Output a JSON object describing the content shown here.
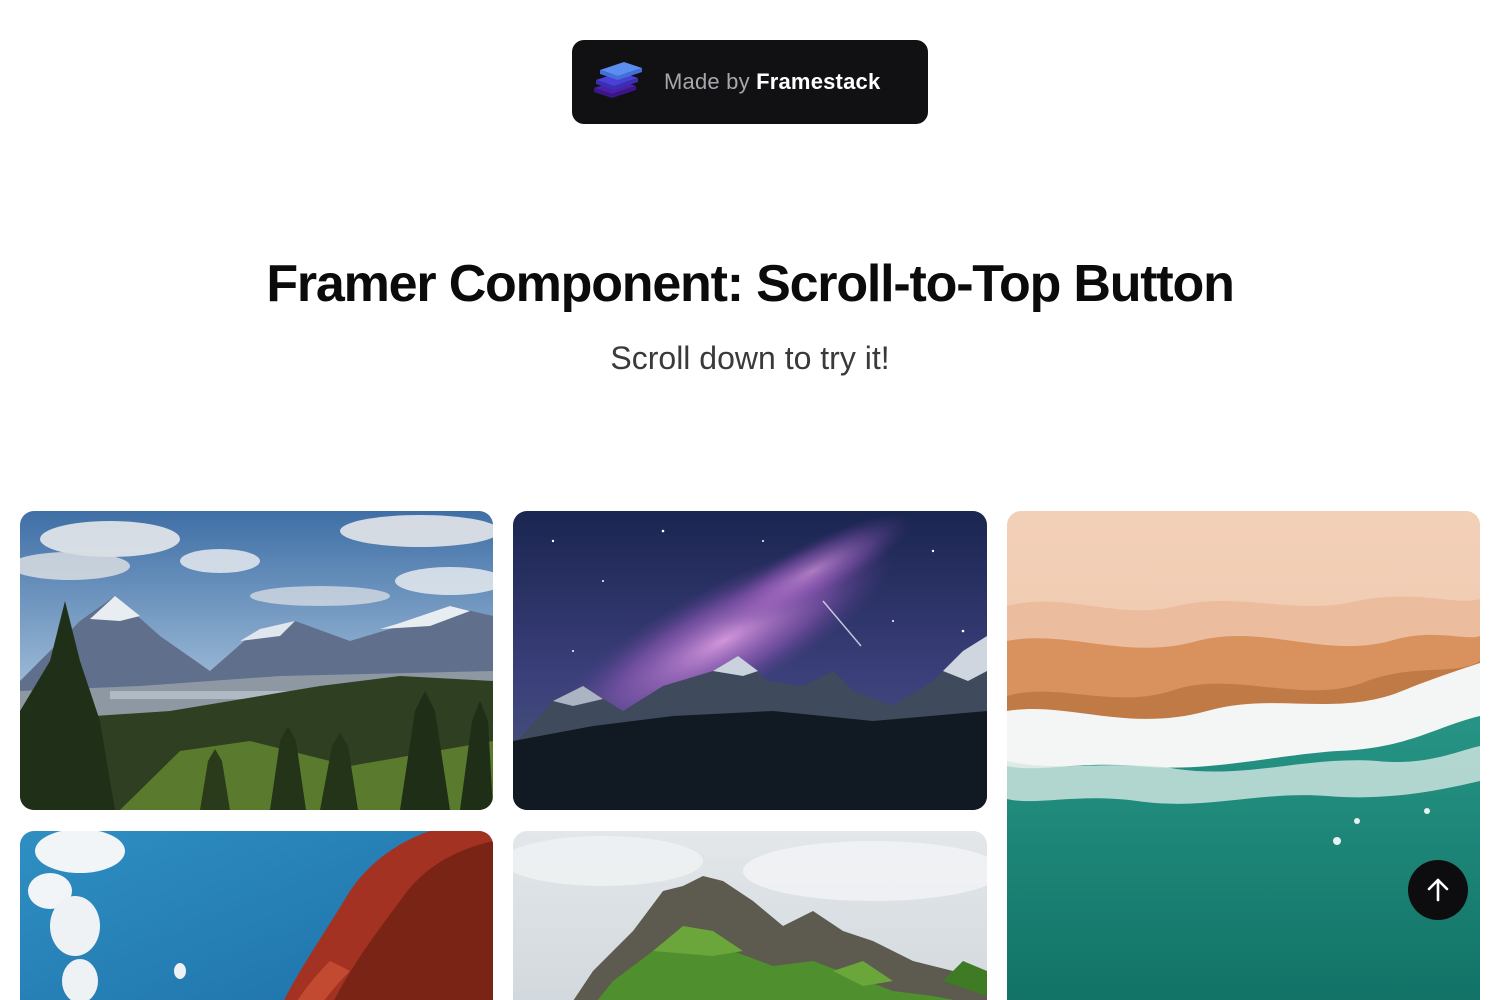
{
  "badge": {
    "prefix": "Made by ",
    "brand": "Framestack",
    "logo_icon": "framestack-layers-icon"
  },
  "heading": {
    "title": "Framer Component: Scroll-to-Top Button",
    "subtitle": "Scroll down to try it!"
  },
  "gallery": {
    "images": [
      "mountain-valley-forest",
      "milky-way-mountains",
      "aerial-beach-waves",
      "red-rock-blue-sky",
      "green-rocky-peak"
    ]
  },
  "scroll_top_button": {
    "icon": "arrow-up-icon"
  },
  "colors": {
    "badge_bg": "#111113",
    "button_bg": "#0d0d0f",
    "title": "#0b0b0b",
    "subtitle": "#3a3a3a"
  }
}
